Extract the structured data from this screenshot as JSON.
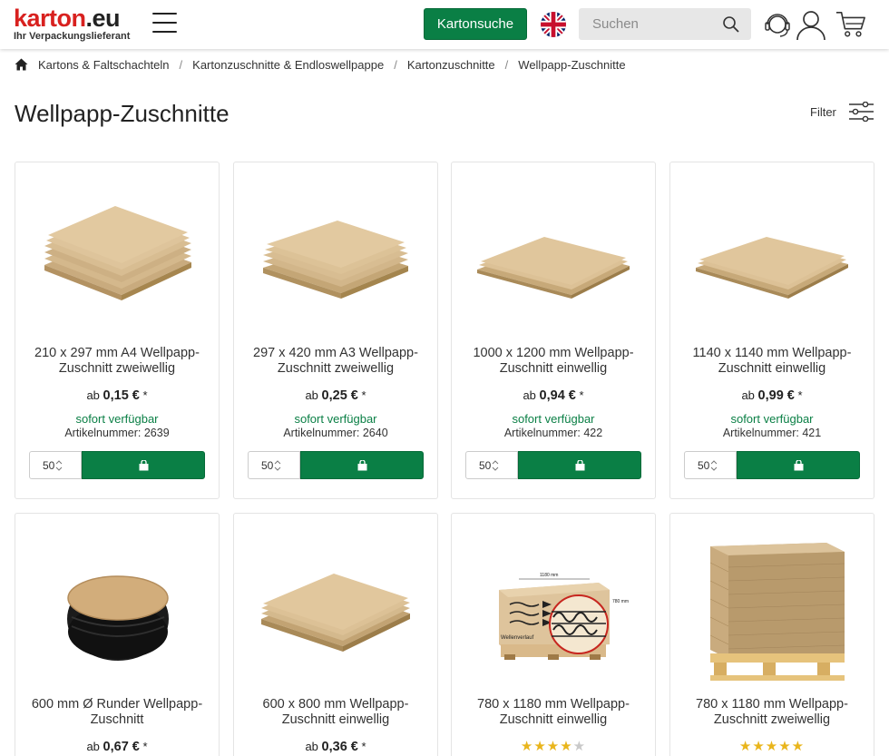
{
  "header": {
    "logo_main": "karton",
    "logo_tld": ".eu",
    "logo_sub": "Ihr Verpackungslieferant",
    "kartonsuche_label": "Kartonsuche",
    "search_placeholder": "Suchen",
    "accent": "#0a7f45",
    "brand_red": "#d8211f"
  },
  "breadcrumb": [
    "Kartons & Faltschachteln",
    "Kartonzuschnitte & Endloswellpappe",
    "Kartonzuschnitte",
    "Wellpapp-Zuschnitte"
  ],
  "page": {
    "title": "Wellpapp-Zuschnitte",
    "filter_label": "Filter"
  },
  "products": [
    {
      "name": "210 x 297 mm A4 Wellpapp-Zuschnitt zweiwellig",
      "price_prefix": "ab",
      "price": "0,15 €",
      "price_suffix": "*",
      "availability": "sofort verfügbar",
      "article": "Artikelnummer: 2639",
      "qty": "50"
    },
    {
      "name": "297 x 420 mm A3 Wellpapp-Zuschnitt zweiwellig",
      "price_prefix": "ab",
      "price": "0,25 €",
      "price_suffix": "*",
      "availability": "sofort verfügbar",
      "article": "Artikelnummer: 2640",
      "qty": "50"
    },
    {
      "name": "1000 x 1200 mm Wellpapp-Zuschnitt einwellig",
      "price_prefix": "ab",
      "price": "0,94 €",
      "price_suffix": "*",
      "availability": "sofort verfügbar",
      "article": "Artikelnummer: 422",
      "qty": "50"
    },
    {
      "name": "1140 x 1140 mm Wellpapp-Zuschnitt einwellig",
      "price_prefix": "ab",
      "price": "0,99 €",
      "price_suffix": "*",
      "availability": "sofort verfügbar",
      "article": "Artikelnummer: 421",
      "qty": "50"
    },
    {
      "name": "600 mm Ø Runder Wellpapp-Zuschnitt",
      "price_prefix": "ab",
      "price": "0,67 €",
      "price_suffix": "*"
    },
    {
      "name": "600 x 800 mm Wellpapp-Zuschnitt einwellig",
      "price_prefix": "ab",
      "price": "0,36 €",
      "price_suffix": "*"
    },
    {
      "name": "780 x 1180 mm Wellpapp-Zuschnitt einwellig",
      "rating": 4.5
    },
    {
      "name": "780 x 1180 mm Wellpapp-Zuschnitt zweiwellig",
      "rating": 5
    }
  ],
  "diagram": {
    "dim_top": "1180 mm",
    "dim_side": "780 mm",
    "direction_label": "Wellenverlauf"
  }
}
